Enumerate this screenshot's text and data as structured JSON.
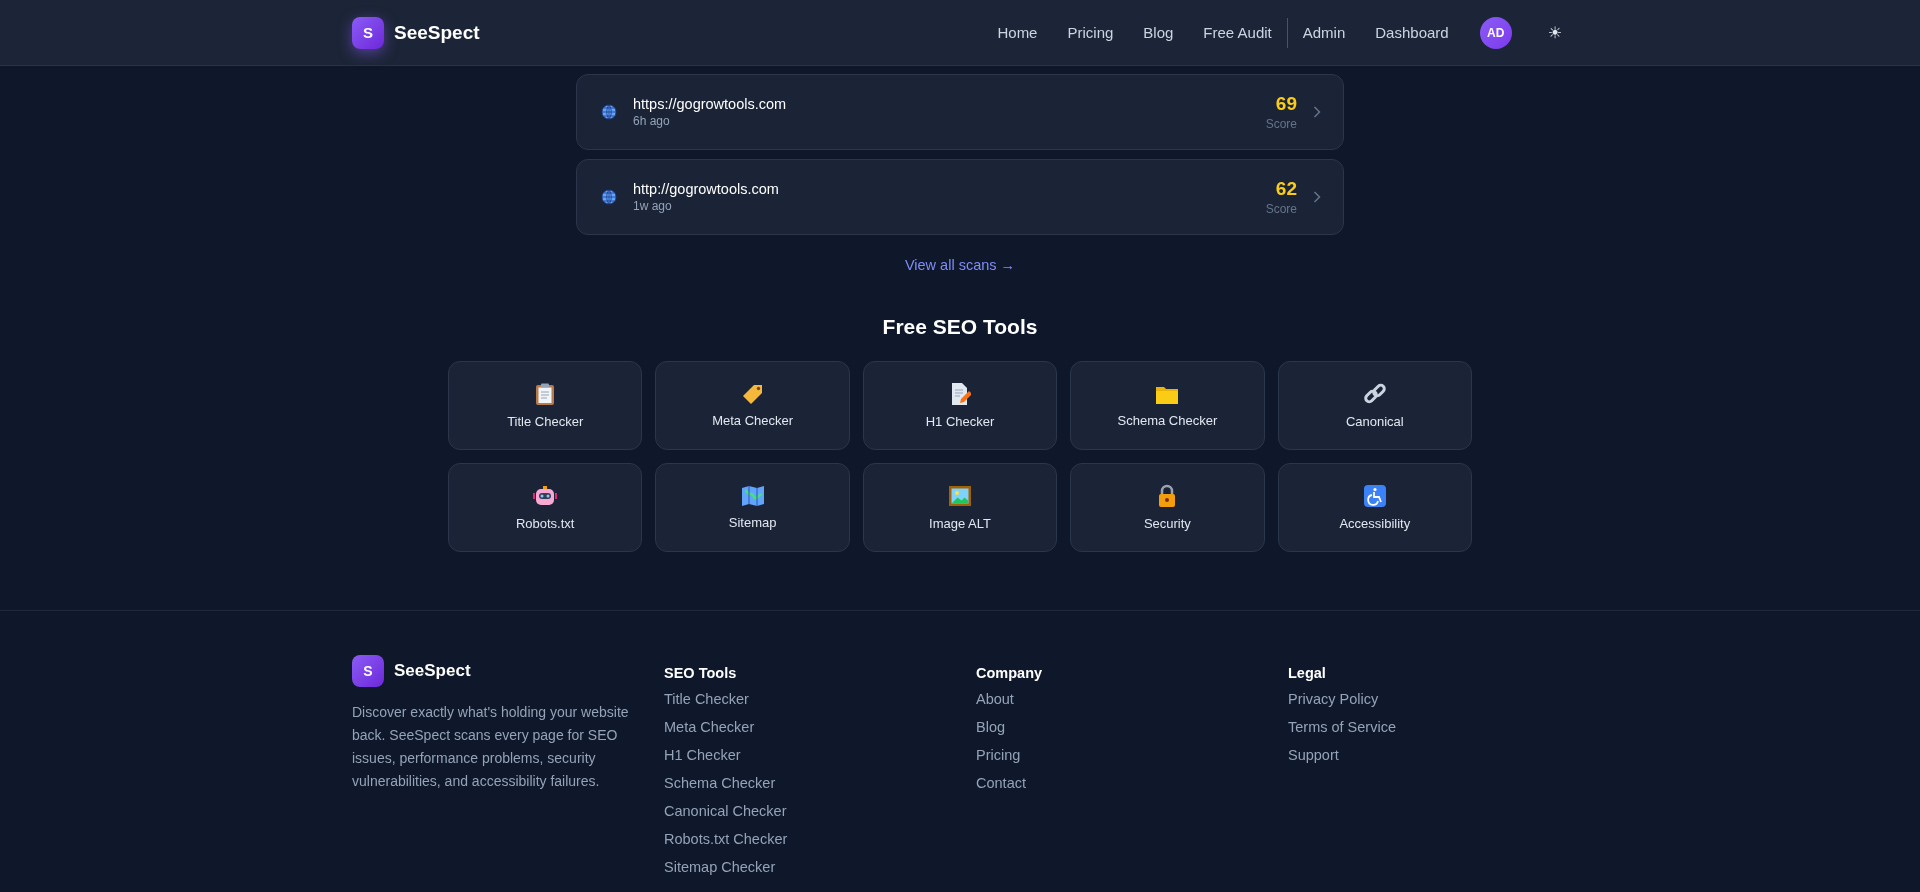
{
  "header": {
    "logo_letter": "S",
    "brand": "SeeSpect",
    "nav": [
      "Home",
      "Pricing",
      "Blog",
      "Free Audit",
      "Admin",
      "Dashboard"
    ],
    "avatar": "AD",
    "theme_toggle": "☀"
  },
  "recent_scans": [
    {
      "url": "https://gogrowtools.com",
      "time": "6h ago",
      "score": "69",
      "score_label": "Score"
    },
    {
      "url": "http://gogrowtools.com",
      "time": "1w ago",
      "score": "62",
      "score_label": "Score"
    }
  ],
  "view_all": "View all scans →",
  "tools_title": "Free SEO Tools",
  "tools": [
    "Title Checker",
    "Meta Checker",
    "H1 Checker",
    "Schema Checker",
    "Canonical",
    "Robots.txt",
    "Sitemap",
    "Image ALT",
    "Security",
    "Accessibility"
  ],
  "footer": {
    "logo_letter": "S",
    "brand": "SeeSpect",
    "description": "Discover exactly what's holding your website back. SeeSpect scans every page for SEO issues, performance problems, security vulnerabilities, and accessibility failures.",
    "columns": [
      {
        "heading": "SEO Tools",
        "links": [
          "Title Checker",
          "Meta Checker",
          "H1 Checker",
          "Schema Checker",
          "Canonical Checker",
          "Robots.txt Checker",
          "Sitemap Checker"
        ]
      },
      {
        "heading": "Company",
        "links": [
          "About",
          "Blog",
          "Pricing",
          "Contact"
        ]
      },
      {
        "heading": "Legal",
        "links": [
          "Privacy Policy",
          "Terms of Service",
          "Support"
        ]
      }
    ]
  }
}
